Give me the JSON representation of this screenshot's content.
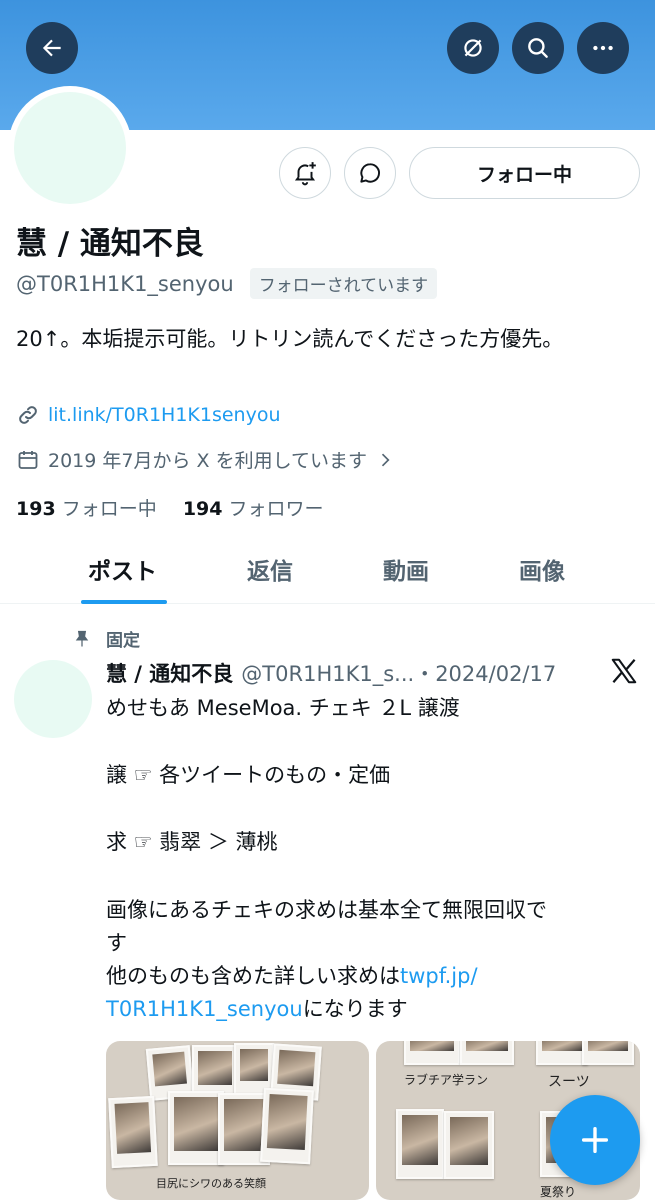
{
  "profile": {
    "name": "慧 / 通知不良",
    "handle": "@T0R1H1K1_senyou",
    "follows_you": "フォローされています",
    "bio": "20↑。本垢提示可能。リトリン読んでくださった方優先。",
    "link": "lit.link/T0R1H1K1senyou",
    "joined": "2019 年7月から X を利用しています",
    "following_count": "193",
    "following_label": "フォロー中",
    "followers_count": "194",
    "followers_label": "フォロワー"
  },
  "actions": {
    "follow_button": "フォロー中"
  },
  "tabs": [
    {
      "label": "ポスト",
      "active": true
    },
    {
      "label": "返信",
      "active": false
    },
    {
      "label": "動画",
      "active": false
    },
    {
      "label": "画像",
      "active": false
    }
  ],
  "post": {
    "pinned_label": "固定",
    "author": "慧 / 通知不良",
    "handle_date": "@T0R1H1K1_s...・2024/02/17",
    "line1": "めせもあ MeseMoa. チェキ ２L 譲渡",
    "line2": "譲 ☞ 各ツイートのもの・定価",
    "line3": "求 ☞ 翡翠 ＞ 薄桃",
    "line4": "画像にあるチェキの求めは基本全て無限回収で",
    "line4b": "す",
    "line5a": "他のものも含めた詳しい求めは",
    "line5link1": "twpf.jp/",
    "line5link2": "T0R1H1K1_senyou",
    "line5end": "になります"
  },
  "media": {
    "left_caption": "目尻にシワのある笑顔",
    "right_caption1": "ラブチア学ラン",
    "right_caption2": "スーツ",
    "right_caption3": "夏祭り"
  },
  "colors": {
    "accent": "#1d9bf0",
    "banner": "#4a9fe6",
    "avatar": "#e8faf3"
  }
}
